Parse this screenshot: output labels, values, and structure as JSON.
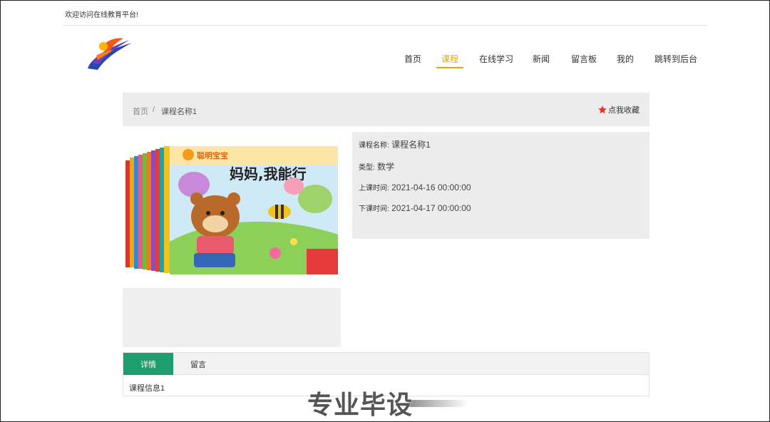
{
  "topbar": {
    "welcome": "欢迎访问在线教育平台!"
  },
  "nav": {
    "items": [
      {
        "label": "首页",
        "active": false
      },
      {
        "label": "课程",
        "active": true
      },
      {
        "label": "在线学习",
        "active": false
      },
      {
        "label": "新闻",
        "active": false
      },
      {
        "label": "留言板",
        "active": false
      },
      {
        "label": "我的",
        "active": false
      },
      {
        "label": "跳转到后台",
        "active": false
      }
    ],
    "accent_color": "#e0a800"
  },
  "breadcrumb": {
    "home": "首页",
    "separator": "/",
    "current": "课程名称1",
    "favorite_label": "点我收藏",
    "favorite_icon": "star-icon",
    "favorite_icon_color": "#e53222"
  },
  "cover": {
    "brand": "聪明宝宝",
    "title": "妈妈,我能行"
  },
  "course": {
    "name_label": "课程名称:",
    "name": "课程名称1",
    "type_label": "类型:",
    "type": "数学",
    "start_label": "上课时间:",
    "start": "2021-04-16 00:00:00",
    "end_label": "下课时间:",
    "end": "2021-04-17 00:00:00"
  },
  "tabs": {
    "items": [
      {
        "label": "详情",
        "active": true
      },
      {
        "label": "留言",
        "active": false
      }
    ],
    "active_color": "#1e9e6e",
    "content": "课程信息1"
  },
  "watermark": "专业毕设"
}
